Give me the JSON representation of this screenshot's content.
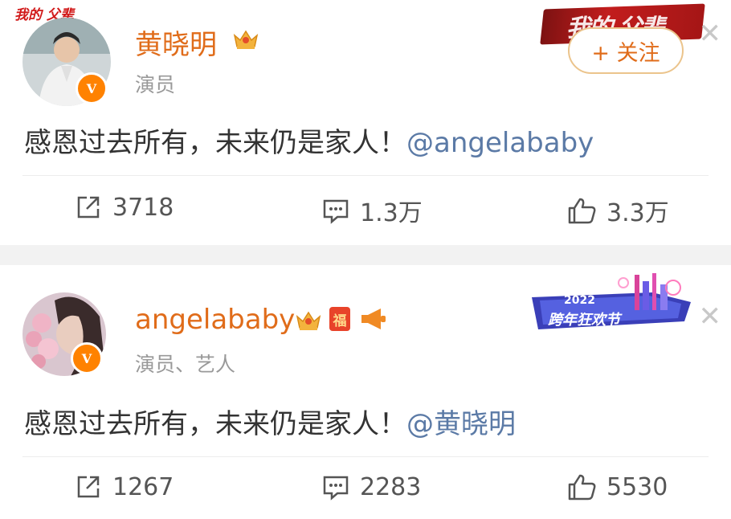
{
  "posts": [
    {
      "user": {
        "name": "黄晓明",
        "subtitle": "演员",
        "top_banner": "我的 父辈"
      },
      "follow_label": "+ 关注",
      "content": "感恩过去所有，未来仍是家人！",
      "mention": "@angelababy",
      "actions": {
        "repost": "3718",
        "comment": "1.3万",
        "like": "3.3万"
      }
    },
    {
      "user": {
        "name": "angelababy",
        "subtitle": "演员、艺人",
        "fu_badge": "福"
      },
      "banner_text": {
        "year": "2022",
        "title": "跨年狂欢节"
      },
      "content": "感恩过去所有，未来仍是家人！",
      "mention": "@黄晓明",
      "actions": {
        "repost": "1267",
        "comment": "2283",
        "like": "5530"
      }
    }
  ],
  "colors": {
    "name": "#e06c1a",
    "mention": "#5b7aa6",
    "text": "#333333",
    "badge": "#ff8200"
  },
  "icons": [
    "share-icon",
    "comment-icon",
    "like-icon",
    "crown-icon",
    "close-icon",
    "verified-icon"
  ]
}
